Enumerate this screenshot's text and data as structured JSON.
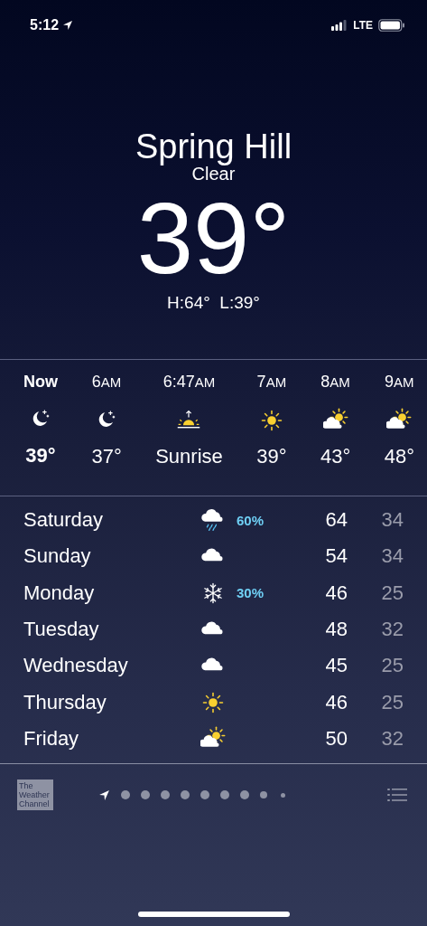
{
  "status_bar": {
    "time": "5:12",
    "network": "LTE"
  },
  "header": {
    "city": "Spring Hill",
    "condition": "Clear",
    "temperature": "39°",
    "high_low": "H:64°  L:39°"
  },
  "hourly": [
    {
      "time": "Now",
      "current": true,
      "kind": "moon",
      "temp": "39°"
    },
    {
      "time": "6",
      "period": "AM",
      "current": false,
      "kind": "moon",
      "temp": "37°"
    },
    {
      "time": "6:47",
      "period": "AM",
      "current": false,
      "kind": "sunrise",
      "temp": "Sunrise"
    },
    {
      "time": "7",
      "period": "AM",
      "current": false,
      "kind": "sun",
      "temp": "39°"
    },
    {
      "time": "8",
      "period": "AM",
      "current": false,
      "kind": "partly",
      "temp": "43°"
    },
    {
      "time": "9",
      "period": "AM",
      "current": false,
      "kind": "partly",
      "temp": "48°"
    }
  ],
  "daily": [
    {
      "day": "Saturday",
      "kind": "rain",
      "chance": "60%",
      "high": "64",
      "low": "34"
    },
    {
      "day": "Sunday",
      "kind": "cloud",
      "high": "54",
      "low": "34"
    },
    {
      "day": "Monday",
      "kind": "snow",
      "chance": "30%",
      "high": "46",
      "low": "25"
    },
    {
      "day": "Tuesday",
      "kind": "cloud",
      "high": "48",
      "low": "32"
    },
    {
      "day": "Wednesday",
      "kind": "cloud",
      "high": "45",
      "low": "25"
    },
    {
      "day": "Thursday",
      "kind": "sun",
      "high": "46",
      "low": "25"
    },
    {
      "day": "Friday",
      "kind": "partly",
      "high": "50",
      "low": "32"
    }
  ],
  "toolbar": {
    "logo": "The Weather Channel",
    "pages": [
      {
        "kind": "location",
        "selected": true
      },
      {
        "kind": "dot",
        "selected": false
      },
      {
        "kind": "dot",
        "selected": false
      },
      {
        "kind": "dot",
        "selected": false
      },
      {
        "kind": "dot",
        "selected": false
      },
      {
        "kind": "dot",
        "selected": false
      },
      {
        "kind": "dot",
        "selected": false
      },
      {
        "kind": "dot",
        "selected": false
      },
      {
        "kind": "dot",
        "selected": false
      },
      {
        "kind": "dot",
        "selected": false
      }
    ]
  }
}
